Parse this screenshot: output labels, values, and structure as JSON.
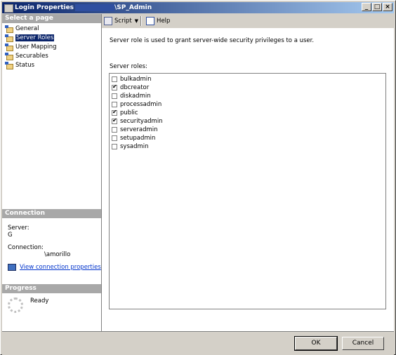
{
  "window": {
    "title_left": "Login Properties -",
    "title_right": "\\SP_Admin",
    "controls": [
      "_",
      "□",
      "×"
    ]
  },
  "left": {
    "select_header": "Select a page",
    "pages": [
      {
        "label": "General",
        "selected": false
      },
      {
        "label": "Server Roles",
        "selected": true
      },
      {
        "label": "User Mapping",
        "selected": false
      },
      {
        "label": "Securables",
        "selected": false
      },
      {
        "label": "Status",
        "selected": false
      }
    ],
    "connection": {
      "header": "Connection",
      "server_label": "Server:",
      "server_value": "G",
      "connection_label": "Connection:",
      "connection_value": "\\amorillo",
      "link": "View connection properties"
    },
    "progress": {
      "header": "Progress",
      "status": "Ready"
    }
  },
  "toolbar": {
    "script_label": "Script",
    "help_label": "Help"
  },
  "main": {
    "description": "Server role is used to grant server-wide security privileges to a user.",
    "roles_label": "Server roles:",
    "roles": [
      {
        "name": "bulkadmin",
        "checked": false
      },
      {
        "name": "dbcreator",
        "checked": true
      },
      {
        "name": "diskadmin",
        "checked": false
      },
      {
        "name": "processadmin",
        "checked": false
      },
      {
        "name": "public",
        "checked": true
      },
      {
        "name": "securityadmin",
        "checked": true
      },
      {
        "name": "serveradmin",
        "checked": false
      },
      {
        "name": "setupadmin",
        "checked": false
      },
      {
        "name": "sysadmin",
        "checked": false
      }
    ]
  },
  "buttons": {
    "ok": "OK",
    "cancel": "Cancel"
  }
}
